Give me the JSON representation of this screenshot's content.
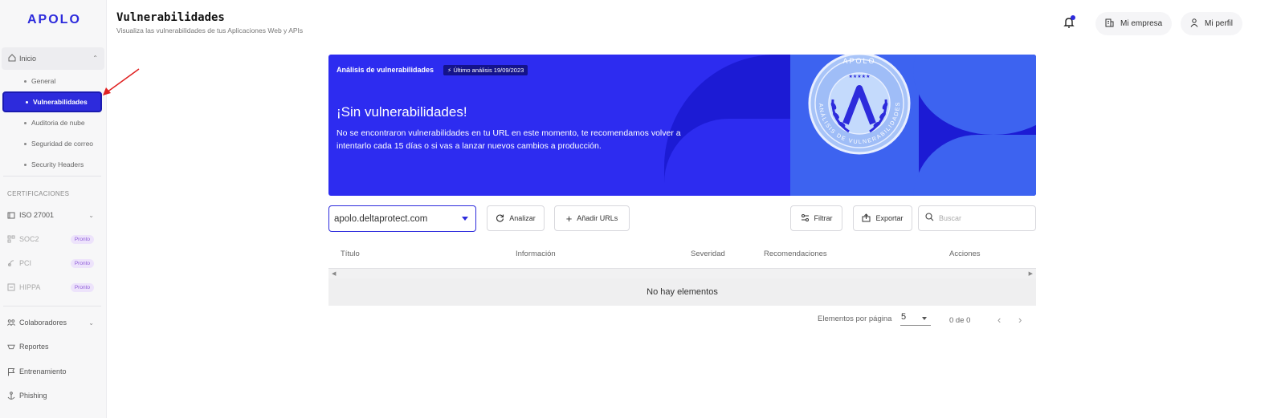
{
  "app": {
    "logo": "APOLO"
  },
  "sidebar": {
    "group_label": "Inicio",
    "sub_items": [
      {
        "label": "General"
      },
      {
        "label": "Vulnerabilidades",
        "active": true
      },
      {
        "label": "Auditoria de nube"
      },
      {
        "label": "Seguridad de correo"
      },
      {
        "label": "Security Headers"
      }
    ],
    "certifications_label": "CERTIFICACIONES",
    "certifications": [
      {
        "label": "ISO 27001",
        "icon": "iso-icon"
      },
      {
        "label": "SOC2",
        "badge": "Pronto",
        "icon": "soc2-icon"
      },
      {
        "label": "PCI",
        "badge": "Pronto",
        "icon": "pci-icon"
      },
      {
        "label": "HIPPA",
        "badge": "Pronto",
        "icon": "hippa-icon"
      }
    ],
    "bottom_items": [
      {
        "label": "Colaboradores",
        "icon": "users-icon"
      },
      {
        "label": "Reportes",
        "icon": "reports-icon"
      },
      {
        "label": "Entrenamiento",
        "icon": "flag-icon"
      },
      {
        "label": "Phishing",
        "icon": "anchor-icon"
      }
    ]
  },
  "header": {
    "title": "Vulnerabilidades",
    "subtitle": "Visualiza las vulnerabilidades de tus Aplicaciones Web y APIs",
    "company_button": "Mi empresa",
    "profile_button": "Mi perfil"
  },
  "banner": {
    "label": "Análisis de vulnerabilidades",
    "tag": "⚡ Último análisis 19/09/2023",
    "heading": "¡Sin vulnerabilidades!",
    "text": "No se encontraron vulnerabilidades en tu URL en este momento, te recomendamos volver a intentarlo cada 15 días o si vas a lanzar nuevos cambios a producción.",
    "seal_top": "APOLO",
    "seal_ring": "ANÁLISIS DE VULNERABILIDADES"
  },
  "toolbar": {
    "url_select": "apolo.deltaprotect.com",
    "analyze": "Analizar",
    "add_urls": "Añadir URLs",
    "filter": "Filtrar",
    "export": "Exportar",
    "search_placeholder": "Buscar"
  },
  "table": {
    "columns": [
      "Título",
      "Información",
      "Severidad",
      "Recomendaciones",
      "Acciones"
    ],
    "empty_message": "No hay elementos"
  },
  "pagination": {
    "per_page_label": "Elementos por página",
    "per_page_value": "5",
    "count": "0 de 0"
  },
  "colors": {
    "primary": "#2d2bdc",
    "banner": "#2d2cf0",
    "badge_text": "#8e5bd8",
    "annotation": "#e02020"
  }
}
